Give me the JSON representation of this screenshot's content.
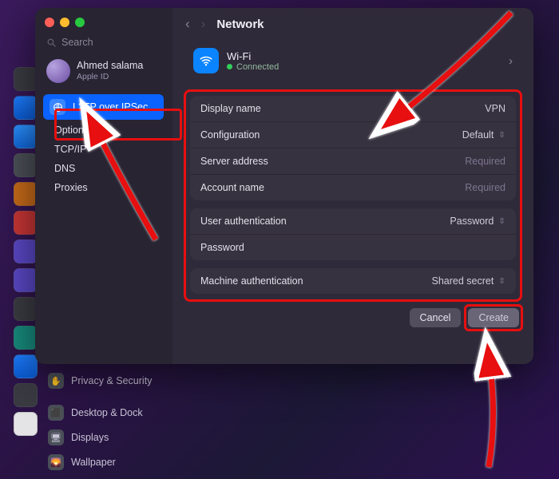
{
  "traffic": {
    "close": "#ff5f57",
    "min": "#febc2e",
    "max": "#28c840"
  },
  "search": {
    "placeholder": "Search"
  },
  "profile": {
    "name": "Ahmed salama",
    "sub": "Apple ID"
  },
  "sidebar": {
    "active": {
      "icon": "globe",
      "label": "L2TP over IPSec"
    },
    "subitems": [
      {
        "label": "Options"
      },
      {
        "label": "TCP/IP"
      },
      {
        "label": "DNS"
      },
      {
        "label": "Proxies"
      }
    ]
  },
  "header": {
    "back": "‹",
    "fwd": "›",
    "title": "Network"
  },
  "wifi": {
    "title": "Wi-Fi",
    "status": "Connected",
    "chev": "›"
  },
  "form": {
    "group1": [
      {
        "label": "Display name",
        "value": "VPN",
        "type": "text"
      },
      {
        "label": "Configuration",
        "value": "Default",
        "type": "popup"
      },
      {
        "label": "Server address",
        "placeholder": "Required",
        "type": "text"
      },
      {
        "label": "Account name",
        "placeholder": "Required",
        "type": "text"
      }
    ],
    "group2": [
      {
        "label": "User authentication",
        "value": "Password",
        "type": "popup"
      },
      {
        "label": "Password",
        "value": "",
        "type": "text"
      }
    ],
    "group3": [
      {
        "label": "Machine authentication",
        "value": "Shared secret",
        "type": "popup"
      }
    ]
  },
  "footer": {
    "cancel": "Cancel",
    "create": "Create"
  },
  "under_items": [
    {
      "icon": "hand",
      "label": "Privacy & Security"
    },
    {
      "icon": "desktop",
      "label": "Desktop & Dock"
    },
    {
      "icon": "display",
      "label": "Displays"
    },
    {
      "icon": "photo",
      "label": "Wallpaper"
    }
  ],
  "glyph": {
    "updown": "⇳",
    "chev_r": "›",
    "search": "🔍"
  }
}
